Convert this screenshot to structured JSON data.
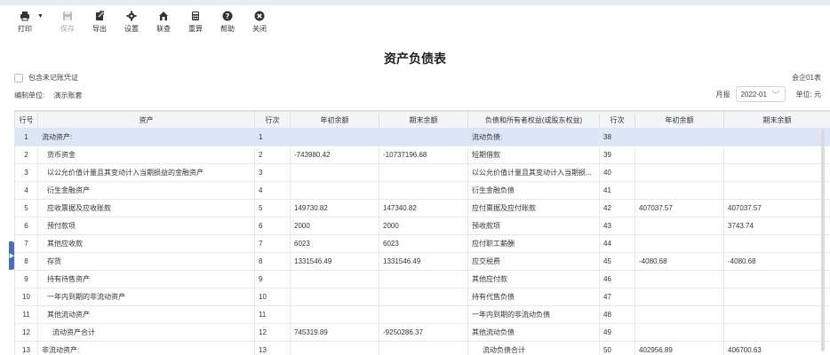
{
  "toolbar": {
    "print": "打印",
    "save": "保存",
    "export": "导出",
    "settings": "设置",
    "link_query": "联查",
    "recalc": "重算",
    "help": "帮助",
    "close": "关闭"
  },
  "report_title": "资产负债表",
  "include_unposted": "包含未记账凭证",
  "form_code": "会企01表",
  "company_label": "编制单位:",
  "company_name": "演示账套",
  "period_label": "月报",
  "period_value": "2022-01",
  "unit_label": "单位: 元",
  "columns": [
    "行号",
    "资产",
    "行次",
    "年初余额",
    "期末余额",
    "负债和所有者权益(或股东权益)",
    "行次",
    "年初余额",
    "期末余额"
  ],
  "rows": [
    [
      "1",
      "流动资产:",
      "1",
      "",
      "",
      "流动负债:",
      "38",
      "",
      ""
    ],
    [
      "2",
      "货币资金",
      "2",
      "-743980.42",
      "-10737196.68",
      "短期借款",
      "39",
      "",
      ""
    ],
    [
      "3",
      "以公允价值计量且其变动计入当期损益的金融资产",
      "3",
      "",
      "",
      "以公允价值计量且其变动计入当期损...",
      "40",
      "",
      ""
    ],
    [
      "4",
      "衍生金融资产",
      "4",
      "",
      "",
      "衍生金融负债",
      "41",
      "",
      ""
    ],
    [
      "5",
      "应收票据及应收账款",
      "5",
      "149730.82",
      "147340.82",
      "应付票据及应付账款",
      "42",
      "407037.57",
      "407037.57"
    ],
    [
      "6",
      "预付款项",
      "6",
      "2000",
      "2000",
      "预收款项",
      "43",
      "",
      "3743.74"
    ],
    [
      "7",
      "其他应收款",
      "7",
      "6023",
      "6023",
      "应付职工薪酬",
      "44",
      "",
      ""
    ],
    [
      "8",
      "存货",
      "8",
      "1331546.49",
      "1331546.49",
      "应交税费",
      "45",
      "-4080.68",
      "-4080.68"
    ],
    [
      "9",
      "持有待售资产",
      "9",
      "",
      "",
      "其他应付款",
      "46",
      "",
      ""
    ],
    [
      "10",
      "一年内到期的非流动资产",
      "10",
      "",
      "",
      "持有代售负债",
      "47",
      "",
      ""
    ],
    [
      "11",
      "其他流动资产",
      "11",
      "",
      "",
      "一年内到期的非流动负债",
      "48",
      "",
      ""
    ],
    [
      "12",
      "流动资产合计",
      "12",
      "745319.89",
      "-9250286.37",
      "其他流动负债",
      "49",
      "",
      ""
    ],
    [
      "13",
      "非流动资产:",
      "13",
      "",
      "",
      "流动负债合计",
      "50",
      "402956.89",
      "406700.63"
    ]
  ]
}
